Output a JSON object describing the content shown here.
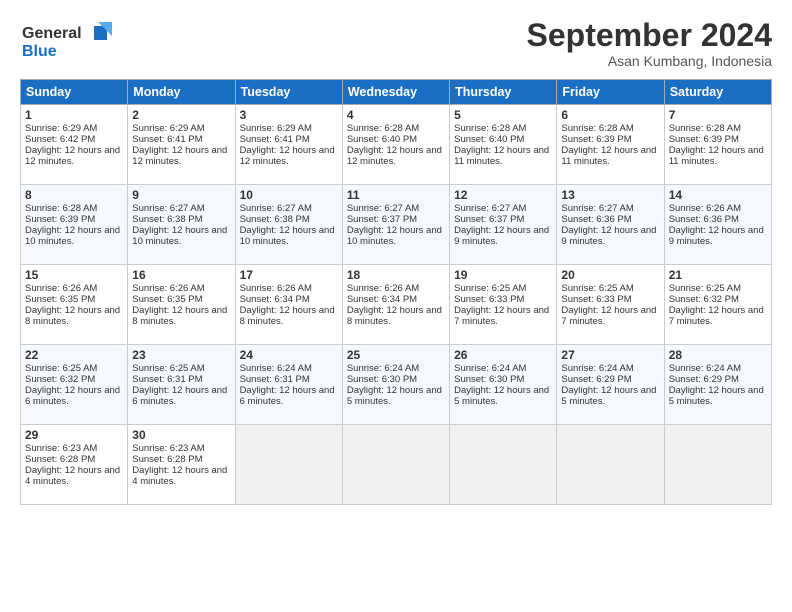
{
  "logo": {
    "line1": "General",
    "line2": "Blue"
  },
  "title": "September 2024",
  "subtitle": "Asan Kumbang, Indonesia",
  "days_header": [
    "Sunday",
    "Monday",
    "Tuesday",
    "Wednesday",
    "Thursday",
    "Friday",
    "Saturday"
  ],
  "weeks": [
    [
      {
        "num": "1",
        "sr": "6:29 AM",
        "ss": "6:42 PM",
        "dl": "12 hours and 12 minutes."
      },
      {
        "num": "2",
        "sr": "6:29 AM",
        "ss": "6:41 PM",
        "dl": "12 hours and 12 minutes."
      },
      {
        "num": "3",
        "sr": "6:29 AM",
        "ss": "6:41 PM",
        "dl": "12 hours and 12 minutes."
      },
      {
        "num": "4",
        "sr": "6:28 AM",
        "ss": "6:40 PM",
        "dl": "12 hours and 12 minutes."
      },
      {
        "num": "5",
        "sr": "6:28 AM",
        "ss": "6:40 PM",
        "dl": "12 hours and 11 minutes."
      },
      {
        "num": "6",
        "sr": "6:28 AM",
        "ss": "6:39 PM",
        "dl": "12 hours and 11 minutes."
      },
      {
        "num": "7",
        "sr": "6:28 AM",
        "ss": "6:39 PM",
        "dl": "12 hours and 11 minutes."
      }
    ],
    [
      {
        "num": "8",
        "sr": "6:28 AM",
        "ss": "6:39 PM",
        "dl": "12 hours and 10 minutes."
      },
      {
        "num": "9",
        "sr": "6:27 AM",
        "ss": "6:38 PM",
        "dl": "12 hours and 10 minutes."
      },
      {
        "num": "10",
        "sr": "6:27 AM",
        "ss": "6:38 PM",
        "dl": "12 hours and 10 minutes."
      },
      {
        "num": "11",
        "sr": "6:27 AM",
        "ss": "6:37 PM",
        "dl": "12 hours and 10 minutes."
      },
      {
        "num": "12",
        "sr": "6:27 AM",
        "ss": "6:37 PM",
        "dl": "12 hours and 9 minutes."
      },
      {
        "num": "13",
        "sr": "6:27 AM",
        "ss": "6:36 PM",
        "dl": "12 hours and 9 minutes."
      },
      {
        "num": "14",
        "sr": "6:26 AM",
        "ss": "6:36 PM",
        "dl": "12 hours and 9 minutes."
      }
    ],
    [
      {
        "num": "15",
        "sr": "6:26 AM",
        "ss": "6:35 PM",
        "dl": "12 hours and 8 minutes."
      },
      {
        "num": "16",
        "sr": "6:26 AM",
        "ss": "6:35 PM",
        "dl": "12 hours and 8 minutes."
      },
      {
        "num": "17",
        "sr": "6:26 AM",
        "ss": "6:34 PM",
        "dl": "12 hours and 8 minutes."
      },
      {
        "num": "18",
        "sr": "6:26 AM",
        "ss": "6:34 PM",
        "dl": "12 hours and 8 minutes."
      },
      {
        "num": "19",
        "sr": "6:25 AM",
        "ss": "6:33 PM",
        "dl": "12 hours and 7 minutes."
      },
      {
        "num": "20",
        "sr": "6:25 AM",
        "ss": "6:33 PM",
        "dl": "12 hours and 7 minutes."
      },
      {
        "num": "21",
        "sr": "6:25 AM",
        "ss": "6:32 PM",
        "dl": "12 hours and 7 minutes."
      }
    ],
    [
      {
        "num": "22",
        "sr": "6:25 AM",
        "ss": "6:32 PM",
        "dl": "12 hours and 6 minutes."
      },
      {
        "num": "23",
        "sr": "6:25 AM",
        "ss": "6:31 PM",
        "dl": "12 hours and 6 minutes."
      },
      {
        "num": "24",
        "sr": "6:24 AM",
        "ss": "6:31 PM",
        "dl": "12 hours and 6 minutes."
      },
      {
        "num": "25",
        "sr": "6:24 AM",
        "ss": "6:30 PM",
        "dl": "12 hours and 5 minutes."
      },
      {
        "num": "26",
        "sr": "6:24 AM",
        "ss": "6:30 PM",
        "dl": "12 hours and 5 minutes."
      },
      {
        "num": "27",
        "sr": "6:24 AM",
        "ss": "6:29 PM",
        "dl": "12 hours and 5 minutes."
      },
      {
        "num": "28",
        "sr": "6:24 AM",
        "ss": "6:29 PM",
        "dl": "12 hours and 5 minutes."
      }
    ],
    [
      {
        "num": "29",
        "sr": "6:23 AM",
        "ss": "6:28 PM",
        "dl": "12 hours and 4 minutes."
      },
      {
        "num": "30",
        "sr": "6:23 AM",
        "ss": "6:28 PM",
        "dl": "12 hours and 4 minutes."
      },
      null,
      null,
      null,
      null,
      null
    ]
  ]
}
